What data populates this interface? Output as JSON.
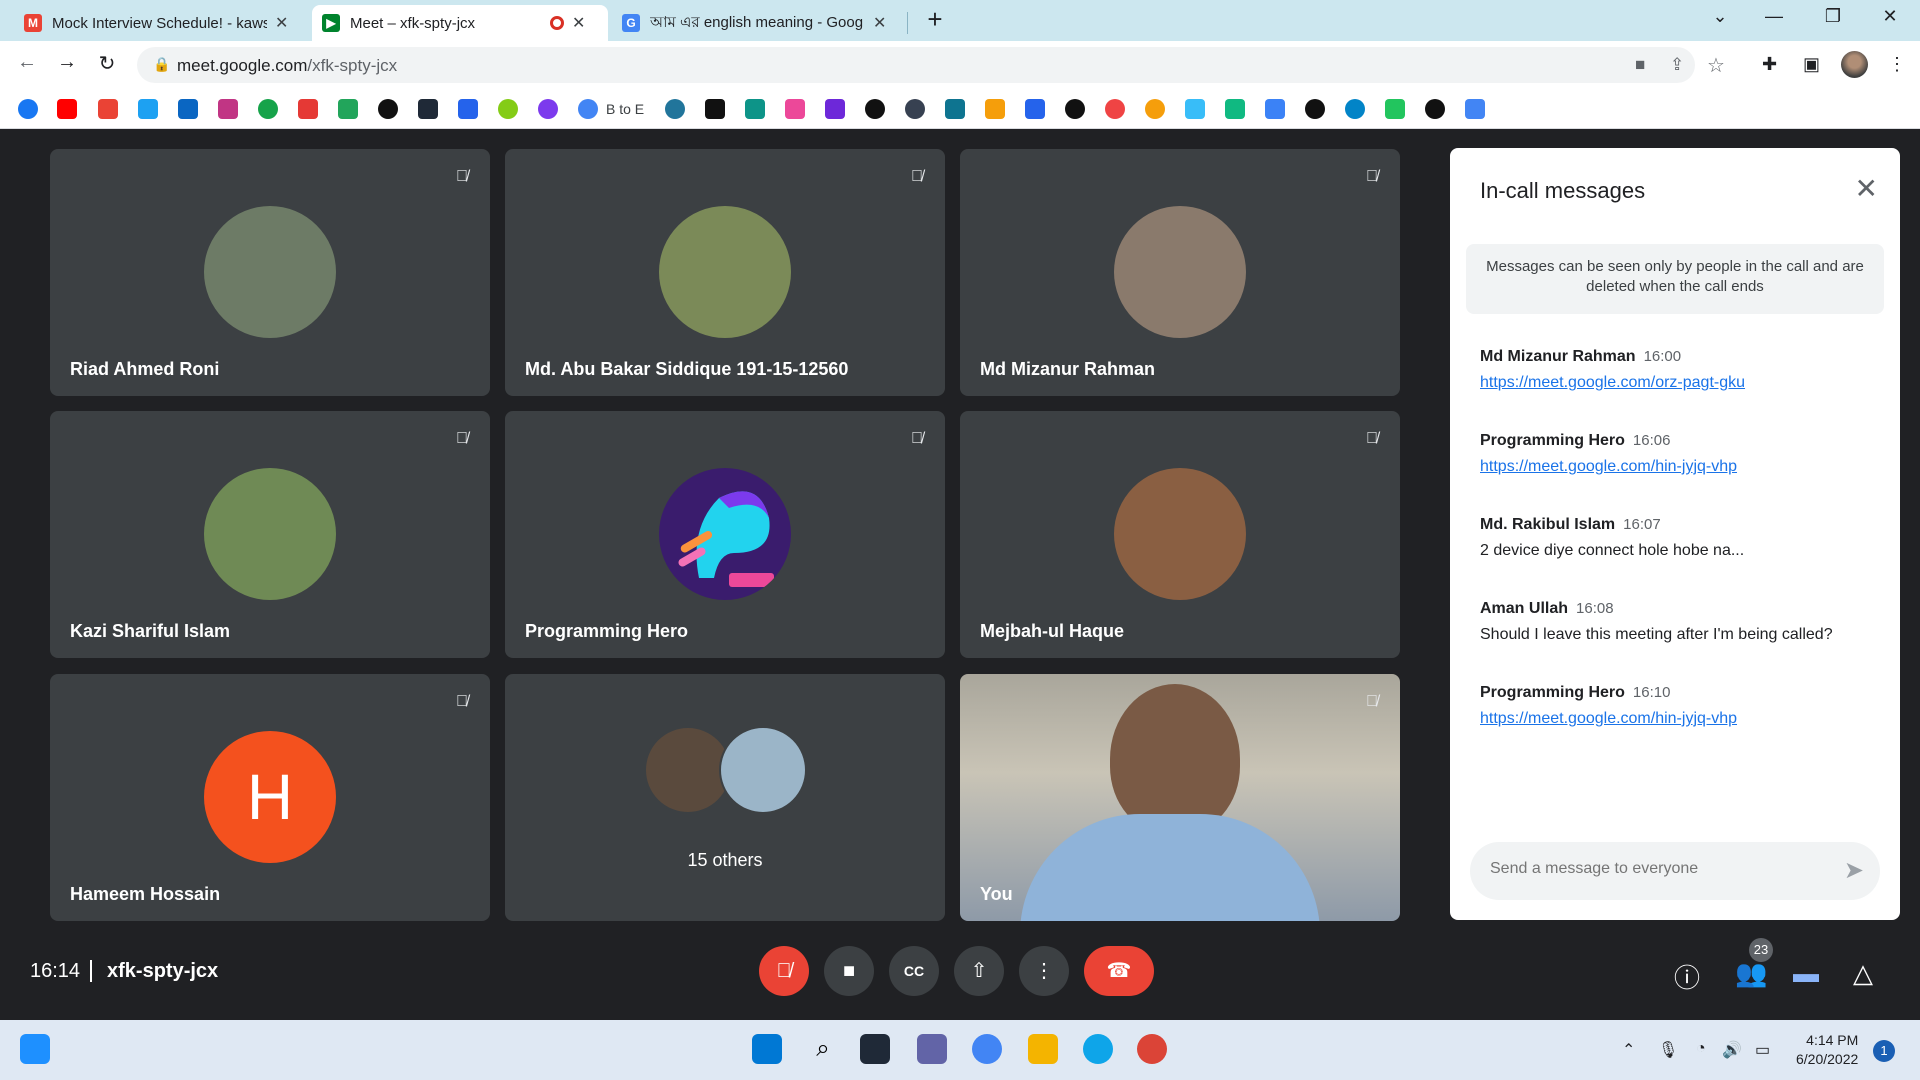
{
  "browser": {
    "tabs": [
      {
        "title": "Mock Interview Schedule! - kaws",
        "favicon": "gmail-icon",
        "color": "#ea4335"
      },
      {
        "title": "Meet – xfk-spty-jcx",
        "favicon": "meet-icon",
        "color": "#00832d"
      },
      {
        "title": "আম এর english meaning - Goog",
        "favicon": "google-icon",
        "color": "#4285f4"
      }
    ],
    "new_tab": "+",
    "url_host": "meet.google.com",
    "url_path": "/xfk-spty-jcx",
    "bookmarks_text": "B to E"
  },
  "tiles": [
    {
      "name": "Riad Ahmed Roni",
      "avatar_color": "#6d7b66"
    },
    {
      "name": "Md. Abu Bakar Siddique 191-15-12560",
      "avatar_color": "#7b8a58"
    },
    {
      "name": "Md Mizanur Rahman",
      "avatar_color": "#8a7a6c"
    },
    {
      "name": "Kazi Shariful Islam",
      "avatar_color": "#6f8a55"
    },
    {
      "name": "Programming Hero",
      "avatar_color": "#3a1c6d"
    },
    {
      "name": "Mejbah-ul Haque",
      "avatar_color": "#8a5f42"
    },
    {
      "name": "Hameem Hossain",
      "avatar_color": "#f4511e",
      "initial": "H"
    }
  ],
  "others": {
    "label": "15 others"
  },
  "self": {
    "name": "You"
  },
  "chat": {
    "title": "In-call messages",
    "notice": "Messages can be seen only by people in the call and are deleted when the call ends",
    "messages": [
      {
        "sender": "Md Mizanur Rahman",
        "time": "16:00",
        "text": "https://meet.google.com/orz-pagt-gku",
        "link": true
      },
      {
        "sender": "Programming Hero",
        "time": "16:06",
        "text": "https://meet.google.com/hin-jyjq-vhp",
        "link": true
      },
      {
        "sender": "Md. Rakibul Islam",
        "time": "16:07",
        "text": "2 device diye connect hole hobe na...",
        "link": false
      },
      {
        "sender": "Aman Ullah",
        "time": "16:08",
        "text": "Should I leave this meeting after I'm being called?",
        "link": false
      },
      {
        "sender": "Programming Hero",
        "time": "16:10",
        "text": "https://meet.google.com/hin-jyjq-vhp",
        "link": true
      }
    ],
    "input_placeholder": "Send a message to everyone"
  },
  "meeting": {
    "time": "16:14",
    "code": "xfk-spty-jcx",
    "participants_count": "23"
  },
  "taskbar": {
    "time": "4:14 PM",
    "date": "6/20/2022",
    "notifications": "1"
  }
}
